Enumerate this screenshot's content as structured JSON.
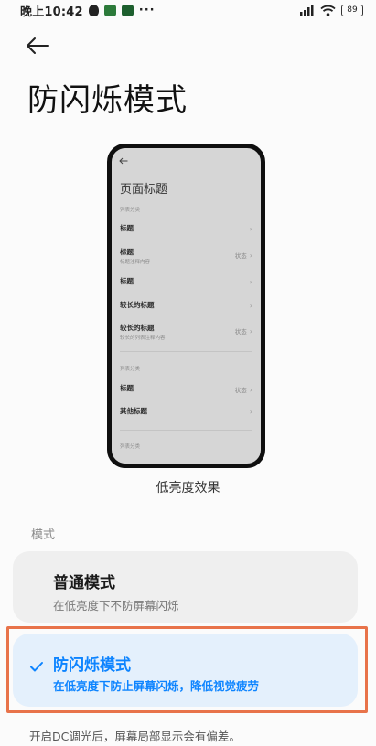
{
  "status_bar": {
    "time": "晚上10:42",
    "dots": "···",
    "battery": "89"
  },
  "header": {
    "title": "防闪烁模式"
  },
  "preview": {
    "title": "页面标题",
    "cat1": "列表分类",
    "cat2": "列表分类",
    "cat3": "列表分类",
    "items": [
      {
        "title": "标题",
        "sub": "",
        "status": ""
      },
      {
        "title": "标题",
        "sub": "标题注释内容",
        "status": "状态"
      },
      {
        "title": "标题",
        "sub": "",
        "status": ""
      },
      {
        "title": "较长的标题",
        "sub": "",
        "status": ""
      },
      {
        "title": "较长的标题",
        "sub": "较长的列表注释内容",
        "status": "状态"
      },
      {
        "title": "标题",
        "sub": "",
        "status": "状态"
      },
      {
        "title": "其他标题",
        "sub": "",
        "status": ""
      }
    ]
  },
  "caption": "低亮度效果",
  "section_label": "模式",
  "modes": {
    "normal": {
      "title": "普通模式",
      "sub": "在低亮度下不防屏幕闪烁"
    },
    "anti_flicker": {
      "title": "防闪烁模式",
      "sub": "在低亮度下防止屏幕闪烁，降低视觉疲劳"
    }
  },
  "footer_note": "开启DC调光后，屏幕局部显示会有偏差。",
  "colors": {
    "accent": "#0d84ff",
    "highlight_border": "#e8734a",
    "selected_bg": "#e4f0fc"
  }
}
